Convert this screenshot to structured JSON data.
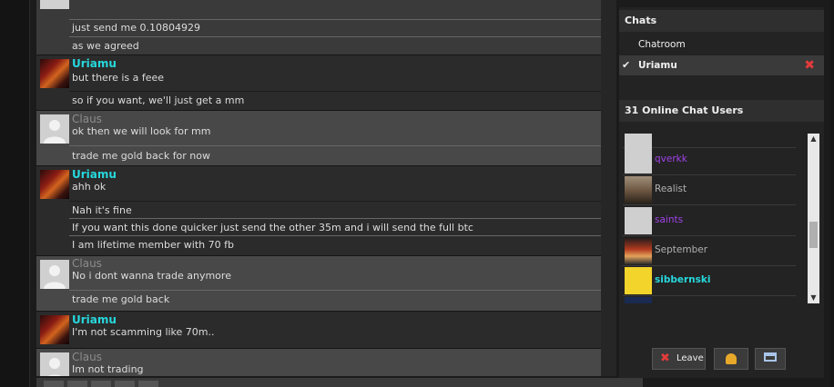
{
  "messages": [
    {
      "user": "",
      "lines": [
        "just send me 0.10804929",
        "as we agreed"
      ]
    },
    {
      "user": "Uriamu",
      "lines": [
        "but there is a feee",
        "so if you want, we'll just get a mm"
      ]
    },
    {
      "user": "Claus",
      "lines": [
        "ok then we will look for mm",
        "trade me gold back for now"
      ]
    },
    {
      "user": "Uriamu",
      "lines": [
        "ahh ok",
        "Nah it's fine",
        "If you want this done quicker just send the other 35m and i will send the full btc",
        "I am lifetime member with 70 fb"
      ]
    },
    {
      "user": "Claus",
      "lines": [
        "No i dont wanna trade anymore",
        "trade me gold back"
      ]
    },
    {
      "user": "Uriamu",
      "lines": [
        "I'm not scamming like 70m.."
      ]
    },
    {
      "user": "Claus",
      "lines": [
        "Im not trading"
      ]
    }
  ],
  "sidebar": {
    "chats_title": "Chats",
    "chats": [
      {
        "label": "Chatroom",
        "active": false
      },
      {
        "label": "Uriamu",
        "active": true
      }
    ],
    "online_title": "31 Online Chat Users",
    "users": [
      {
        "name": "qverkk",
        "color": "purple",
        "avatar": "default"
      },
      {
        "name": "Realist",
        "color": "grey",
        "avatar": "photo"
      },
      {
        "name": "saints",
        "color": "purple",
        "avatar": "default"
      },
      {
        "name": "September",
        "color": "grey",
        "avatar": "anime"
      },
      {
        "name": "sibbernski",
        "color": "cyan",
        "avatar": "spongebob"
      }
    ],
    "buttons": {
      "leave": "Leave"
    }
  },
  "colors": {
    "accent_cyan": "#27d8dd",
    "accent_purple": "#a042e8",
    "close_red": "#e43b3b"
  }
}
